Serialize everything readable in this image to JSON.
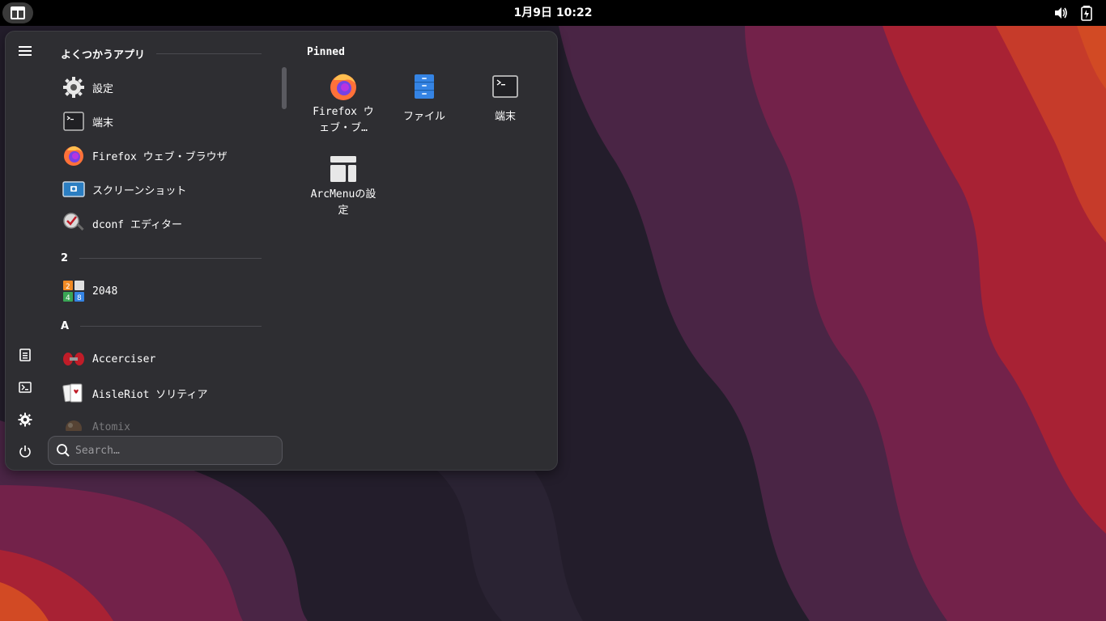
{
  "topbar": {
    "clock": "1月9日  10:22",
    "activities_icon": "arcmenu-icon",
    "tray_icons": [
      "volume-icon",
      "battery-icon"
    ]
  },
  "menu": {
    "favorites_header": "よくつかうアプリ",
    "apps": [
      {
        "label": "設定",
        "icon": "settings-gear-icon"
      },
      {
        "label": "端末",
        "icon": "terminal-icon"
      },
      {
        "label": "Firefox ウェブ・ブラウザ",
        "icon": "firefox-icon"
      },
      {
        "label": "スクリーンショット",
        "icon": "screenshot-icon"
      },
      {
        "label": "dconf エディター",
        "icon": "dconf-editor-icon"
      }
    ],
    "section_2": "2",
    "apps_2": [
      {
        "label": "2048",
        "icon": "2048-icon"
      }
    ],
    "section_a": "A",
    "apps_a": [
      {
        "label": "Accerciser",
        "icon": "accerciser-icon"
      },
      {
        "label": "AisleRiot ソリティア",
        "icon": "aisleriot-icon"
      },
      {
        "label": "Atomix",
        "icon": "atomix-icon"
      }
    ],
    "search_placeholder": "Search…",
    "pinned_header": "Pinned",
    "pinned": [
      {
        "label": "Firefox ウェブ・ブ…",
        "icon": "firefox-icon"
      },
      {
        "label": "ファイル",
        "icon": "files-icon"
      },
      {
        "label": "端末",
        "icon": "terminal-icon"
      },
      {
        "label": "ArcMenuの設定",
        "icon": "arcmenu-settings-icon"
      }
    ],
    "side_buttons": [
      "hamburger-icon",
      "documents-icon",
      "terminal-icon",
      "settings-icon",
      "power-icon"
    ]
  },
  "colors": {
    "wallpaper_dark": "#231d2b",
    "wallpaper_purple": "#4a2545",
    "wallpaper_magenta": "#73224a",
    "wallpaper_red": "#a82234",
    "wallpaper_orange": "#d24a24",
    "menu_bg": "#2e2e32"
  }
}
